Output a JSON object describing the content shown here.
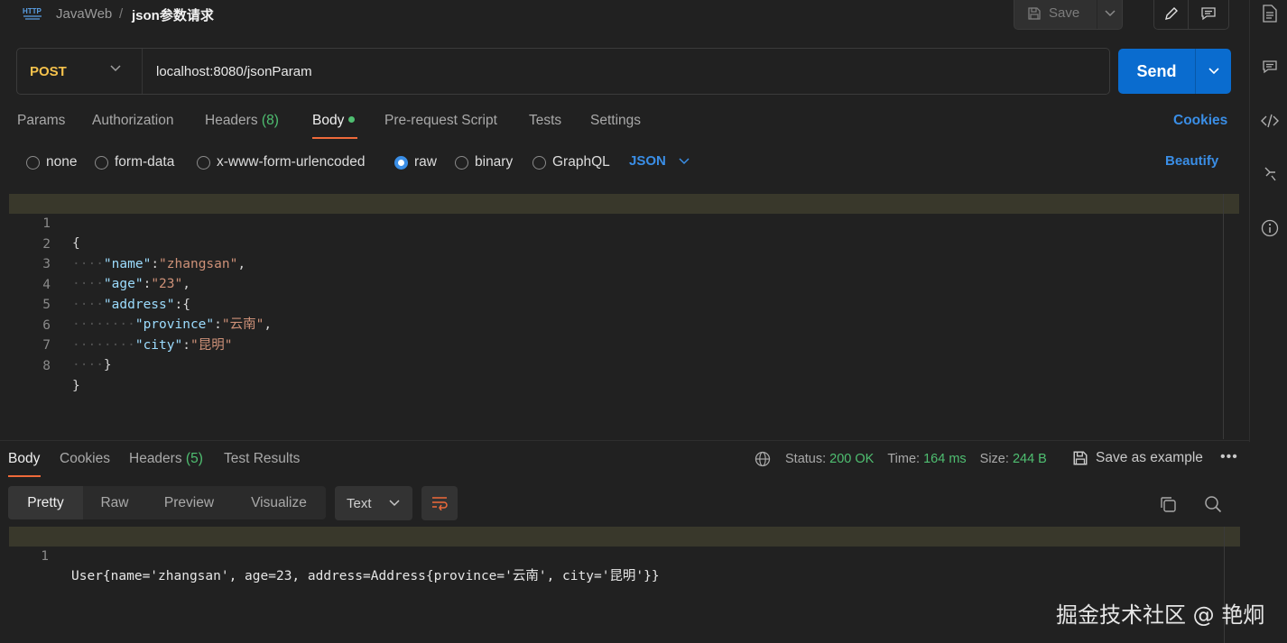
{
  "breadcrumb": {
    "parent": "JavaWeb",
    "separator": "/",
    "current": "json参数请求"
  },
  "toolbar": {
    "save_label": "Save"
  },
  "request": {
    "method": "POST",
    "url": "localhost:8080/jsonParam",
    "send_label": "Send"
  },
  "request_tabs": {
    "params": "Params",
    "authorization": "Authorization",
    "headers": "Headers",
    "headers_count": "(8)",
    "body": "Body",
    "pre_request": "Pre-request Script",
    "tests": "Tests",
    "settings": "Settings",
    "cookies": "Cookies"
  },
  "body_types": {
    "none": "none",
    "form_data": "form-data",
    "urlencoded": "x-www-form-urlencoded",
    "raw": "raw",
    "binary": "binary",
    "graphql": "GraphQL",
    "selected": "raw",
    "format": "JSON",
    "beautify": "Beautify"
  },
  "editor": {
    "line_numbers": [
      "1",
      "2",
      "3",
      "4",
      "5",
      "6",
      "7",
      "8"
    ],
    "lines": {
      "l1": "{",
      "l2_key": "\"name\"",
      "l2_val": "\"zhangsan\"",
      "l3_key": "\"age\"",
      "l3_val": "\"23\"",
      "l4_key": "\"address\"",
      "l4_open": "{",
      "l5_key": "\"province\"",
      "l5_val": "\"云南\"",
      "l6_key": "\"city\"",
      "l6_val": "\"昆明\"",
      "l7": "}",
      "l8": "}"
    }
  },
  "response_tabs": {
    "body": "Body",
    "cookies": "Cookies",
    "headers": "Headers",
    "headers_count": "(5)",
    "test_results": "Test Results"
  },
  "response_meta": {
    "status_label": "Status:",
    "status_value": "200 OK",
    "time_label": "Time:",
    "time_value": "164 ms",
    "size_label": "Size:",
    "size_value": "244 B",
    "save_example": "Save as example",
    "more": "•••"
  },
  "response_view": {
    "pretty": "Pretty",
    "raw": "Raw",
    "preview": "Preview",
    "visualize": "Visualize",
    "format": "Text"
  },
  "response_body": {
    "line_number": "1",
    "text": "User{name='zhangsan', age=23, address=Address{province='云南', city='昆明'}}"
  },
  "watermark": "掘金技术社区 @ 艳炯",
  "colors": {
    "background": "#212121",
    "accent_blue": "#0a6ccf",
    "link_blue": "#3a8ee6",
    "method_yellow": "#f5c24c",
    "status_green": "#4fbf71",
    "tab_underline": "#ef6a3a"
  }
}
